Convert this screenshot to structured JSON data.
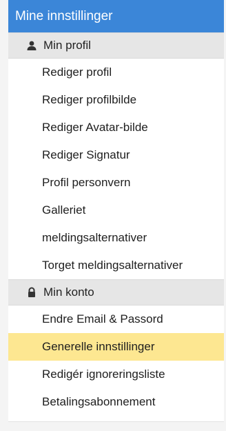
{
  "panel": {
    "title": "Mine innstillinger"
  },
  "sections": [
    {
      "title": "Min profil",
      "icon": "user-icon",
      "items": [
        {
          "label": "Rediger profil"
        },
        {
          "label": "Rediger profilbilde"
        },
        {
          "label": "Rediger Avatar-bilde"
        },
        {
          "label": "Rediger Signatur"
        },
        {
          "label": "Profil personvern"
        },
        {
          "label": "Galleriet"
        },
        {
          "label": "meldingsalternativer"
        },
        {
          "label": "Torget meldingsalternativer"
        }
      ]
    },
    {
      "title": "Min konto",
      "icon": "lock-icon",
      "items": [
        {
          "label": "Endre Email & Passord"
        },
        {
          "label": "Generelle innstillinger",
          "active": true
        },
        {
          "label": "Redigér ignoreringsliste"
        },
        {
          "label": "Betalingsabonnement"
        }
      ]
    }
  ],
  "colors": {
    "header_bg": "#3b86d8",
    "section_bg": "#e6e6e6",
    "active_bg": "#fde791"
  }
}
